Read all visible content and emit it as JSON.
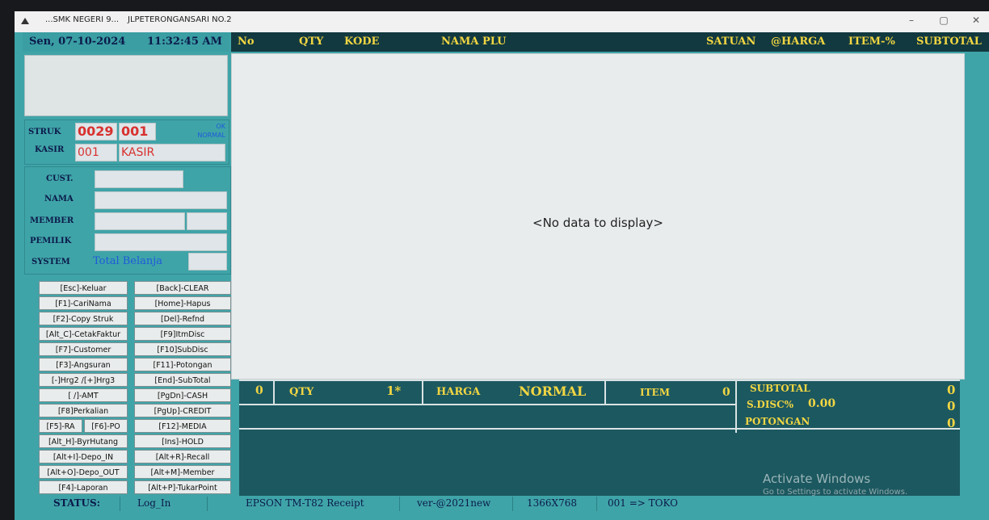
{
  "window": {
    "title_left": "...SMK NEGERI 9...",
    "title_right": "JLPETERONGANSARI NO.2",
    "minimize": "–",
    "maximize": "▢",
    "close": "✕"
  },
  "header": {
    "date": "Sen, 07-10-2024",
    "time": "11:32:45 AM"
  },
  "columns": {
    "no": "No",
    "qty": "QTY",
    "kode": "KODE",
    "nama_plu": "NAMA PLU",
    "satuan": "SATUAN",
    "harga": "@HARGA",
    "item_pct": "ITEM-%",
    "subtotal": "SUBTOTAL"
  },
  "struk": {
    "label": "STRUK",
    "number": "0029",
    "sub": "001",
    "ok": "OK",
    "mode": "NORMAL",
    "kasir_label": "KASIR",
    "kasir_id": "001",
    "kasir_name": "KASIR"
  },
  "customer": {
    "cust": "CUST.",
    "nama": "NAMA",
    "member": "MEMBER",
    "pemilik": "PEMILIK",
    "system": "SYSTEM",
    "total_belanja": "Total Belanja"
  },
  "keys": [
    "[Esc]-Keluar",
    "[Back]-CLEAR",
    "[F1]-CariNama",
    "[Home]-Hapus",
    "[F2]-Copy Struk",
    "[Del]-Refnd",
    "[Alt_C]-CetakFaktur",
    "[F9]ItmDisc",
    "[F7]-Customer",
    "[F10]SubDisc",
    "[F3]-Angsuran",
    "[F11]-Potongan",
    "[-]Hrg2 /[+]Hrg3",
    "[End]-SubTotal",
    "[ /]-AMT",
    "[PgDn]-CASH",
    "[F8]Perkalian",
    "[PgUp]-CREDIT",
    "[F5]-RA",
    "[F6]-PO",
    "[F12]-MEDIA",
    "[Alt_H]-ByrHutang",
    "[Ins]-HOLD",
    "[Alt+I]-Depo_IN",
    "[Alt+R]-Recall",
    "[Alt+O]-Depo_OUT",
    "[Alt+M]-Member",
    "[F4]-Laporan",
    "[Alt+P]-TukarPoint"
  ],
  "grid": {
    "empty_text": "<No data to display>"
  },
  "summary": {
    "count": "0",
    "qty_label": "QTY",
    "qty_value": "1*",
    "harga_label": "HARGA",
    "harga_mode": "NORMAL",
    "item_label": "ITEM",
    "item_value": "0",
    "subtotal_label": "SUBTOTAL",
    "subtotal_value": "0",
    "sdisc_label": "S.DISC%",
    "sdisc_pct": "0.00",
    "sdisc_value": "0",
    "potongan_label": "POTONGAN",
    "potongan_value": "0"
  },
  "watermark": {
    "line1": "Activate Windows",
    "line2": "Go to Settings to activate Windows."
  },
  "status": {
    "label": "STATUS:",
    "login": "Log_In",
    "printer": "EPSON TM-T82 Receipt",
    "version": "ver-@2021new",
    "resolution": "1366X768",
    "toko": "001 => TOKO"
  }
}
